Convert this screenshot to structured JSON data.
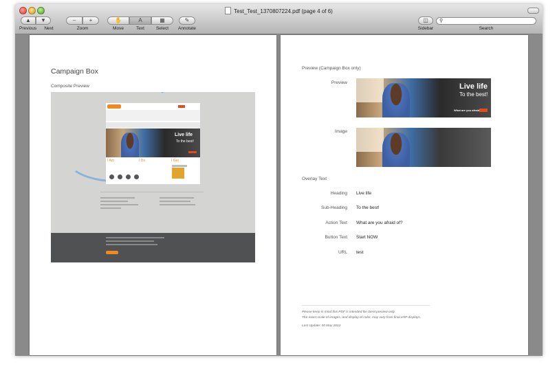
{
  "window": {
    "title": "Test_Test_1370807224.pdf (page 4 of 6)"
  },
  "toolbar": {
    "previous": "Previous",
    "next": "Next",
    "zoom": "Zoom",
    "zoom_out_glyph": "–",
    "zoom_in_glyph": "+",
    "move": "Move",
    "text": "Text",
    "text_glyph": "A",
    "select": "Select",
    "annotate": "Annotate",
    "sidebar": "Sidebar",
    "search": "Search",
    "search_value": ""
  },
  "left_page": {
    "heading": "Campaign Box",
    "subheading": "Composite Preview"
  },
  "right_page": {
    "preview_heading": "Preview (Campaign Box only)",
    "preview_label": "Preview",
    "image_label": "Image",
    "overlay_heading": "Overlay Text",
    "fields": [
      {
        "label": "Heading",
        "value": "Live life"
      },
      {
        "label": "Sub-Heading",
        "value": "To the best!"
      },
      {
        "label": "Action Text",
        "value": "What are you afraid of?"
      },
      {
        "label": "Button Text",
        "value": "Start NOW"
      },
      {
        "label": "URL",
        "value": "test"
      }
    ],
    "footnote_1": "Please keep in mind this PDF is intended for client preview only.",
    "footnote_2": "The exact scale of images, and display of color, may vary from final eHP displays.",
    "last_update": "Last Update: 30 May 2012"
  },
  "banner": {
    "heading": "Live life",
    "subheading": "To the best!",
    "action": "What are you afraid of?",
    "button": "Start NOW"
  },
  "composite_site": {
    "col1": "I Am",
    "col2": "I Do",
    "col3": "I Get"
  },
  "colors": {
    "accent": "#e24b1c",
    "footer": "#4f5152"
  }
}
